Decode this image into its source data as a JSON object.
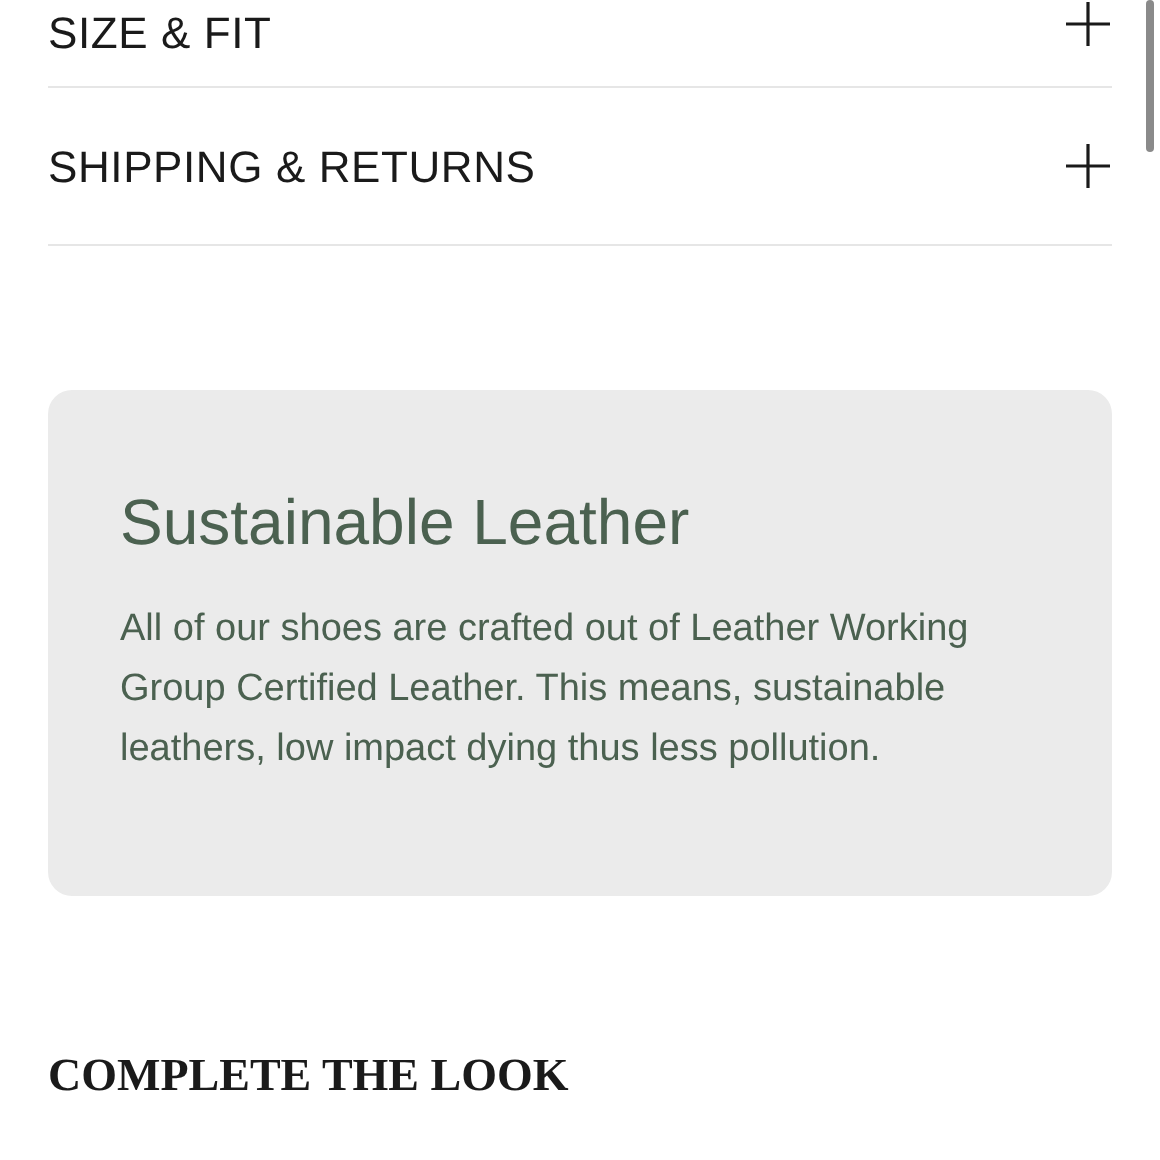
{
  "accordion": [
    {
      "label": "SIZE & FIT",
      "expanded": false
    },
    {
      "label": "SHIPPING & RETURNS",
      "expanded": false
    }
  ],
  "info_card": {
    "title": "Sustainable Leather",
    "body": "All of our shoes are crafted out of Leather Working Group Certified Leather. This means, sustainable leathers, low impact dying thus less pollution."
  },
  "section_heading": "COMPLETE THE LOOK"
}
